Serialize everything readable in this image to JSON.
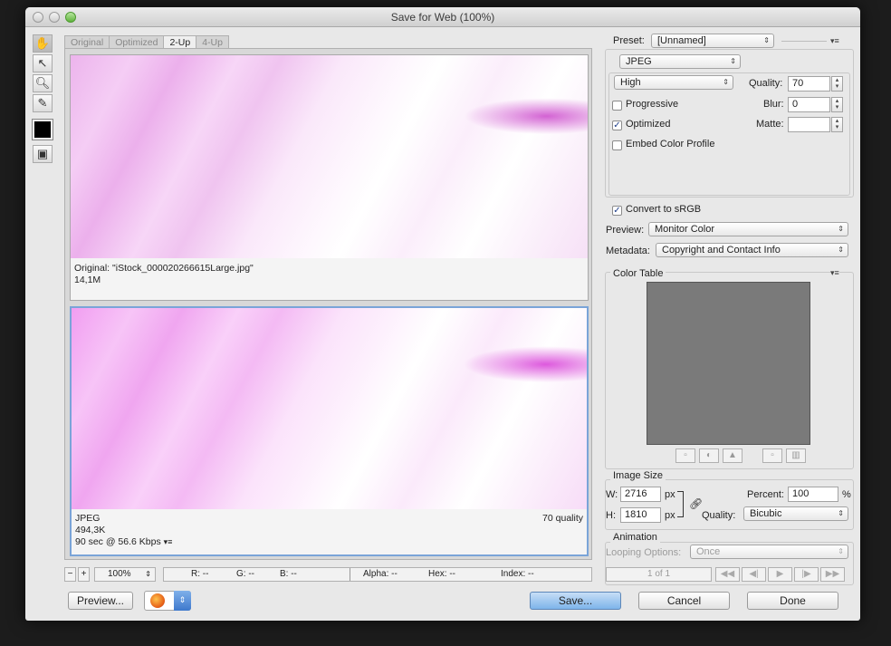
{
  "window": {
    "title": "Save for Web (100%)"
  },
  "view_tabs": [
    {
      "label": "Original",
      "active": false
    },
    {
      "label": "Optimized",
      "active": false
    },
    {
      "label": "2-Up",
      "active": true
    },
    {
      "label": "4-Up",
      "active": false
    }
  ],
  "tools": [
    "hand-icon",
    "slice-select-icon",
    "zoom-icon",
    "eyedropper-icon",
    "eyedropper-color-swatch",
    "toggle-slices-icon"
  ],
  "original_pane": {
    "name": "Original: \"iStock_000020266615Large.jpg\"",
    "size": "14,1M"
  },
  "optimized_pane": {
    "format": "JPEG",
    "size": "494,3K",
    "download": "90 sec @ 56.6 Kbps",
    "quality": "70 quality"
  },
  "status": {
    "zoom": "100%",
    "r": "R: --",
    "g": "G: --",
    "b": "B: --",
    "alpha": "Alpha: --",
    "hex": "Hex: --",
    "index": "Index: --"
  },
  "buttons": {
    "preview": "Preview...",
    "save": "Save...",
    "cancel": "Cancel",
    "done": "Done"
  },
  "settings": {
    "preset_label": "Preset:",
    "preset_value": "[Unnamed]",
    "format": "JPEG",
    "compression": "High",
    "quality_label": "Quality:",
    "quality_value": "70",
    "blur_label": "Blur:",
    "blur_value": "0",
    "matte_label": "Matte:",
    "progressive_label": "Progressive",
    "progressive_checked": false,
    "optimized_label": "Optimized",
    "optimized_checked": true,
    "embed_label": "Embed Color Profile",
    "embed_checked": false,
    "srgb_label": "Convert to sRGB",
    "srgb_checked": true,
    "preview_label": "Preview:",
    "preview_value": "Monitor Color",
    "metadata_label": "Metadata:",
    "metadata_value": "Copyright and Contact Info"
  },
  "color_table": {
    "title": "Color Table",
    "swatch_color": "#7a7a7a"
  },
  "image_size": {
    "title": "Image Size",
    "w_label": "W:",
    "w_value": "2716",
    "h_label": "H:",
    "h_value": "1810",
    "unit": "px",
    "percent_label": "Percent:",
    "percent_value": "100",
    "percent_unit": "%",
    "quality_label": "Quality:",
    "quality_value": "Bicubic"
  },
  "animation": {
    "title": "Animation",
    "looping_label": "Looping Options:",
    "looping_value": "Once",
    "frame_counter": "1 of 1"
  }
}
